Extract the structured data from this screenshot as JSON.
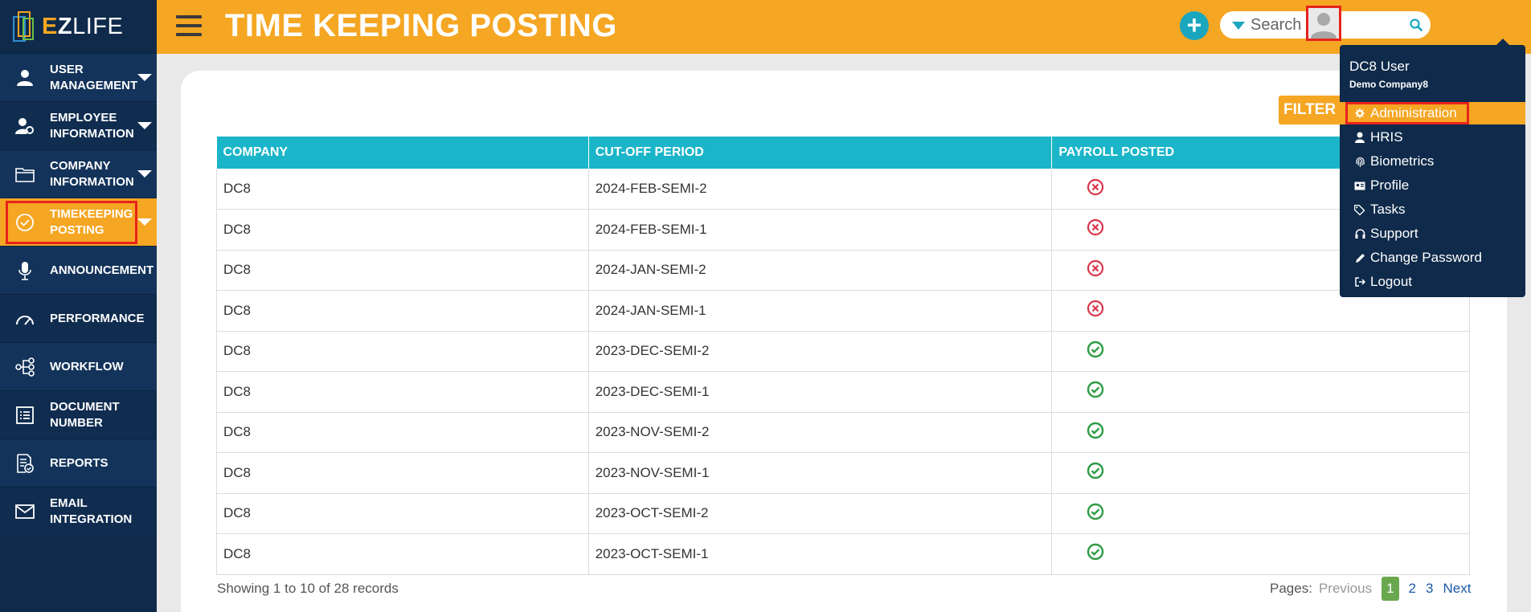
{
  "app": {
    "logo_e": "E",
    "logo_z": "Z",
    "logo_rest": "LIFE"
  },
  "sidebar": {
    "items": [
      {
        "label": "USER MANAGEMENT",
        "icon": "user-icon",
        "caret": true
      },
      {
        "label": "EMPLOYEE INFORMATION",
        "icon": "user-gear-icon",
        "caret": true
      },
      {
        "label": "COMPANY INFORMATION",
        "icon": "folder-icon",
        "caret": true
      },
      {
        "label": "TIMEKEEPING POSTING",
        "icon": "check-circle-icon",
        "caret": true,
        "active": true
      },
      {
        "label": "ANNOUNCEMENT",
        "icon": "microphone-icon",
        "caret": false
      },
      {
        "label": "PERFORMANCE",
        "icon": "gauge-icon",
        "caret": false
      },
      {
        "label": "WORKFLOW",
        "icon": "workflow-icon",
        "caret": false
      },
      {
        "label": "DOCUMENT NUMBER",
        "icon": "list-icon",
        "caret": false
      },
      {
        "label": "REPORTS",
        "icon": "report-icon",
        "caret": false
      },
      {
        "label": "EMAIL INTEGRATION",
        "icon": "envelope-icon",
        "caret": false
      }
    ]
  },
  "header": {
    "title": "TIME KEEPING POSTING",
    "add_label": "+",
    "search_placeholder": "Search"
  },
  "main": {
    "filter_label": "FILTER",
    "columns": [
      "COMPANY",
      "CUT-OFF PERIOD",
      "PAYROLL POSTED"
    ],
    "rows": [
      {
        "company": "DC8",
        "period": "2024-FEB-SEMI-2",
        "posted": false
      },
      {
        "company": "DC8",
        "period": "2024-FEB-SEMI-1",
        "posted": false
      },
      {
        "company": "DC8",
        "period": "2024-JAN-SEMI-2",
        "posted": false
      },
      {
        "company": "DC8",
        "period": "2024-JAN-SEMI-1",
        "posted": false
      },
      {
        "company": "DC8",
        "period": "2023-DEC-SEMI-2",
        "posted": true
      },
      {
        "company": "DC8",
        "period": "2023-DEC-SEMI-1",
        "posted": true
      },
      {
        "company": "DC8",
        "period": "2023-NOV-SEMI-2",
        "posted": true
      },
      {
        "company": "DC8",
        "period": "2023-NOV-SEMI-1",
        "posted": true
      },
      {
        "company": "DC8",
        "period": "2023-OCT-SEMI-2",
        "posted": true
      },
      {
        "company": "DC8",
        "period": "2023-OCT-SEMI-1",
        "posted": true
      }
    ],
    "records_text": "Showing 1 to 10 of 28 records",
    "pager": {
      "label": "Pages:",
      "prev": "Previous",
      "pages": [
        "1",
        "2",
        "3"
      ],
      "next": "Next"
    }
  },
  "dropdown": {
    "user_name": "DC8 User",
    "company": "Demo Company8",
    "items": [
      {
        "label": "Administration",
        "icon": "gear-icon"
      },
      {
        "label": "HRIS",
        "icon": "person-icon"
      },
      {
        "label": "Biometrics",
        "icon": "fingerprint-icon"
      },
      {
        "label": "Profile",
        "icon": "id-card-icon"
      },
      {
        "label": "Tasks",
        "icon": "tags-icon"
      },
      {
        "label": "Support",
        "icon": "headset-icon"
      },
      {
        "label": "Change Password",
        "icon": "pencil-icon"
      },
      {
        "label": "Logout",
        "icon": "sign-out-icon"
      }
    ]
  },
  "colors": {
    "accent": "#f5a623",
    "navy": "#0f2a4a",
    "teal": "#1bb5c9",
    "ok": "#2e9b43",
    "bad": "#d9364a"
  }
}
